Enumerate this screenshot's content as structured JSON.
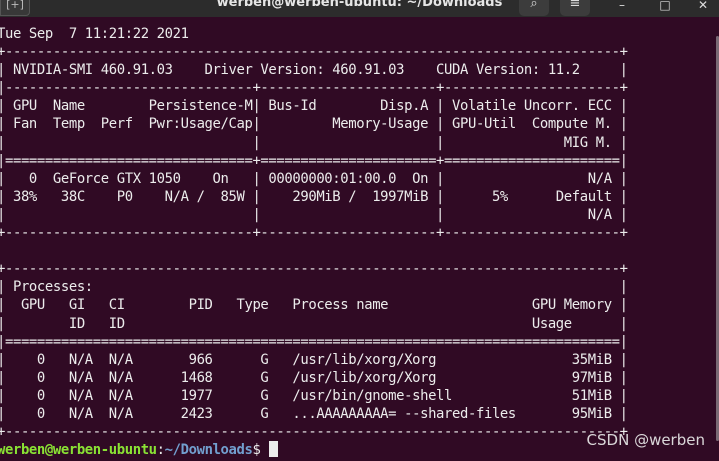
{
  "titlebar": {
    "tab_label": "[+]",
    "title": "werben@werben-ubuntu: ~/Downloads",
    "search_glyph": "⌕",
    "menu_glyph": "≡",
    "minimize_glyph": "–",
    "maximize_glyph": "□",
    "close_glyph": "✕"
  },
  "terminal": {
    "lines": [
      "Tue Sep  7 11:21:22 2021",
      "+-----------------------------------------------------------------------------+",
      "| NVIDIA-SMI 460.91.03    Driver Version: 460.91.03    CUDA Version: 11.2     |",
      "|-------------------------------+----------------------+----------------------+",
      "| GPU  Name        Persistence-M| Bus-Id        Disp.A | Volatile Uncorr. ECC |",
      "| Fan  Temp  Perf  Pwr:Usage/Cap|         Memory-Usage | GPU-Util  Compute M. |",
      "|                               |                      |               MIG M. |",
      "|===============================+======================+======================|",
      "|   0  GeForce GTX 1050    On   | 00000000:01:00.0  On |                  N/A |",
      "| 38%   38C    P0    N/A /  85W |    290MiB /  1997MiB |      5%      Default |",
      "|                               |                      |                  N/A |",
      "+-------------------------------+----------------------+----------------------+",
      "",
      "+-----------------------------------------------------------------------------+",
      "| Processes:                                                                  |",
      "|  GPU   GI   CI        PID   Type   Process name                  GPU Memory |",
      "|        ID   ID                                                   Usage      |",
      "|=============================================================================|",
      "|    0   N/A  N/A       966      G   /usr/lib/xorg/Xorg                 35MiB |",
      "|    0   N/A  N/A      1468      G   /usr/lib/xorg/Xorg                 97MiB |",
      "|    0   N/A  N/A      1977      G   /usr/bin/gnome-shell               51MiB |",
      "|    0   N/A  N/A      2423      G   ...AAAAAAAAA= --shared-files       95MiB |",
      "+-----------------------------------------------------------------------------+"
    ],
    "prompt": {
      "user_host": "werben@werben-ubuntu",
      "separator": ":",
      "path": "~/Downloads",
      "symbol": "$ "
    }
  },
  "watermark": "CSDN @werben"
}
